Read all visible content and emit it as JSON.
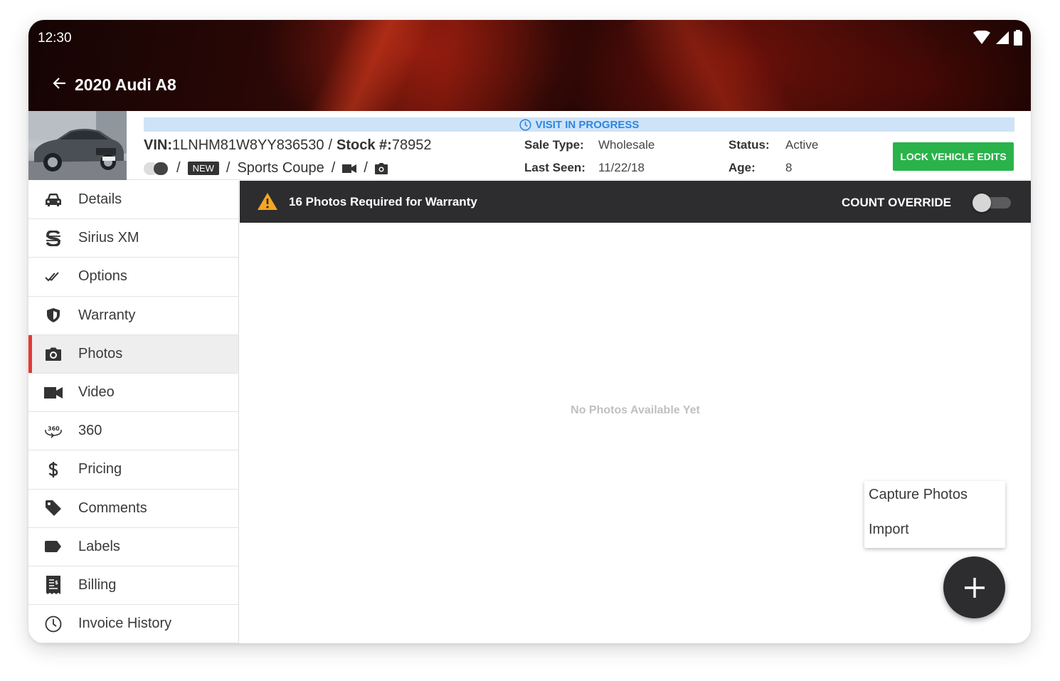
{
  "status_bar": {
    "time": "12:30"
  },
  "header": {
    "title": "2020 Audi A8"
  },
  "vehicle": {
    "visit_banner": "VISIT IN PROGRESS",
    "vin_label": "VIN:",
    "vin": "1LNHM81W8YY836530",
    "stock_label": "Stock #:",
    "stock": "78952",
    "badge": "NEW",
    "body_style": "Sports Coupe",
    "sale_type_label": "Sale Type:",
    "sale_type": "Wholesale",
    "last_seen_label": "Last Seen:",
    "last_seen": "11/22/18",
    "status_label": "Status:",
    "status": "Active",
    "age_label": "Age:",
    "age": "8",
    "lock_button": "LOCK VEHICLE EDITS"
  },
  "sidebar": {
    "items": [
      {
        "label": "Details",
        "icon": "car-icon"
      },
      {
        "label": "Sirius XM",
        "icon": "sirius-icon"
      },
      {
        "label": "Options",
        "icon": "double-check-icon"
      },
      {
        "label": "Warranty",
        "icon": "shield-icon"
      },
      {
        "label": "Photos",
        "icon": "camera-icon",
        "active": true
      },
      {
        "label": "Video",
        "icon": "video-icon"
      },
      {
        "label": "360",
        "icon": "360-icon"
      },
      {
        "label": "Pricing",
        "icon": "dollar-icon"
      },
      {
        "label": "Comments",
        "icon": "tag-icon"
      },
      {
        "label": "Labels",
        "icon": "label-icon"
      },
      {
        "label": "Billing",
        "icon": "receipt-icon"
      },
      {
        "label": "Invoice History",
        "icon": "clock-icon"
      }
    ]
  },
  "photos": {
    "warning": "16 Photos Required for Warranty",
    "count_override_label": "COUNT OVERRIDE",
    "count_override_on": false,
    "empty_message": "No Photos Available Yet",
    "fab_menu": [
      "Capture Photos",
      "Import"
    ]
  },
  "colors": {
    "accent_red": "#e53935",
    "lock_green": "#29b34a",
    "banner_blue": "#2e86de",
    "dark_bar": "#2d2d2f",
    "warning_orange": "#f5a623"
  }
}
